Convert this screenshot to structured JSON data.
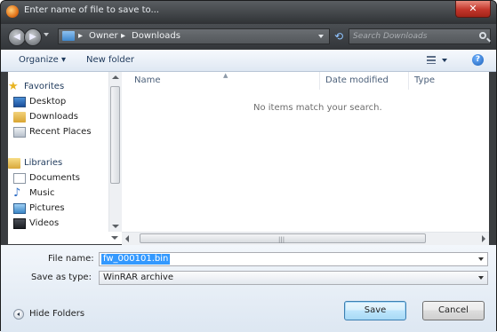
{
  "window": {
    "title": "Enter name of file to save to...",
    "close_label": "✕"
  },
  "address": {
    "segments": [
      "Owner",
      "Downloads"
    ],
    "separator": "▸",
    "search_placeholder": "Search Downloads"
  },
  "toolbar": {
    "organize_label": "Organize ▾",
    "new_folder_label": "New folder",
    "help_label": "?"
  },
  "nav": {
    "favorites_label": "Favorites",
    "favorites": [
      {
        "label": "Desktop"
      },
      {
        "label": "Downloads"
      },
      {
        "label": "Recent Places"
      }
    ],
    "libraries_label": "Libraries",
    "libraries": [
      {
        "label": "Documents"
      },
      {
        "label": "Music"
      },
      {
        "label": "Pictures"
      },
      {
        "label": "Videos"
      }
    ]
  },
  "files": {
    "columns": [
      "Name",
      "Date modified",
      "Type"
    ],
    "empty_message": "No items match your search."
  },
  "form": {
    "file_name_label": "File name:",
    "file_name_value": "fw_000101.bin",
    "save_type_label": "Save as type:",
    "save_type_value": "WinRAR archive"
  },
  "footer": {
    "hide_folders_label": "Hide Folders",
    "save_label": "Save",
    "cancel_label": "Cancel"
  },
  "colors": {
    "accent": "#3399ff",
    "title_bar": "#2f3235",
    "command_bar": "#dfe8f3"
  }
}
